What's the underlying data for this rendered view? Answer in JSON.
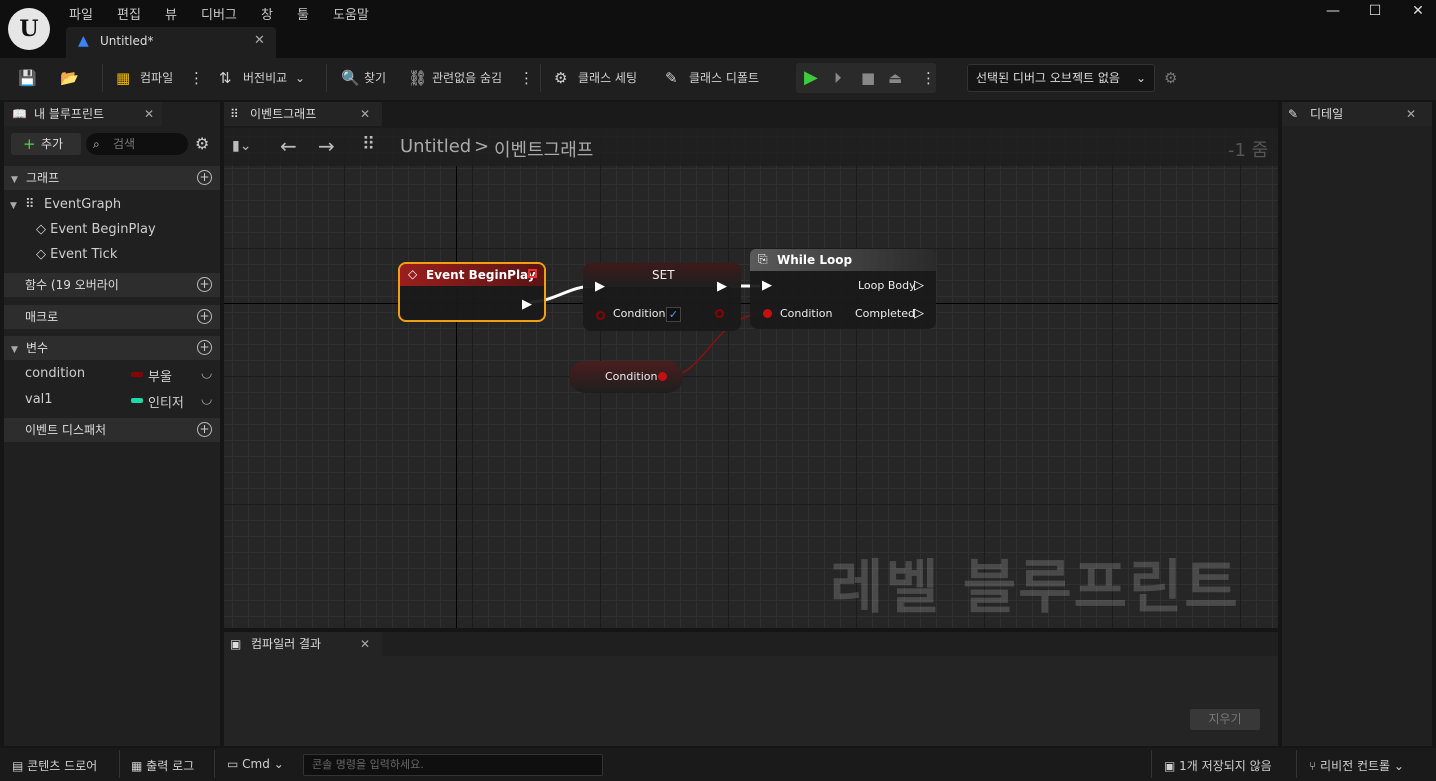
{
  "menu": [
    "파일",
    "편집",
    "뷰",
    "디버그",
    "창",
    "툴",
    "도움말"
  ],
  "doc_tab": "Untitled*",
  "toolbar": {
    "compile": "컴파일",
    "diff": "버전비교",
    "find": "찾기",
    "hide_unrelated": "관련없음 숨김",
    "class_settings": "클래스 세팅",
    "class_defaults": "클래스 디폴트",
    "debug_select": "선택된 디버그 오브젝트 없음"
  },
  "left": {
    "tab": "내 블루프린트",
    "add": "추가",
    "search_placeholder": "검색",
    "graphs_header": "그래프",
    "event_graph": "EventGraph",
    "event_beginplay": "Event BeginPlay",
    "event_tick": "Event Tick",
    "functions_header": "함수 (19 오버라이",
    "macros_header": "매크로",
    "variables_header": "변수",
    "vars": [
      {
        "name": "condition",
        "type": "부울",
        "color": "#8b0000"
      },
      {
        "name": "val1",
        "type": "인티저",
        "color": "#1fd8a8"
      }
    ],
    "dispatchers_header": "이벤트 디스패처"
  },
  "center": {
    "tab": "이벤트그래프",
    "breadcrumb_root": "Untitled",
    "breadcrumb_sep": ">",
    "breadcrumb_leaf": "이벤트그래프",
    "zoom": "-1 줌",
    "watermark": "레벨 블루프린트"
  },
  "nodes": {
    "beginplay_title": "Event BeginPlay",
    "set_title": "SET",
    "set_condition": "Condition",
    "while_title": "While Loop",
    "while_loop_body": "Loop Body",
    "while_condition": "Condition",
    "while_completed": "Completed",
    "getter_label": "Condition"
  },
  "bottom": {
    "tab": "컴파일러 결과",
    "clear": "지우기"
  },
  "right": {
    "tab": "디테일"
  },
  "status": {
    "content_drawer": "콘텐츠 드로어",
    "output_log": "출력 로그",
    "cmd": "Cmd",
    "console_placeholder": "콘솔 명령을 입력하세요.",
    "unsaved": "1개 저장되지 않음",
    "revision": "리비전 컨트롤"
  }
}
